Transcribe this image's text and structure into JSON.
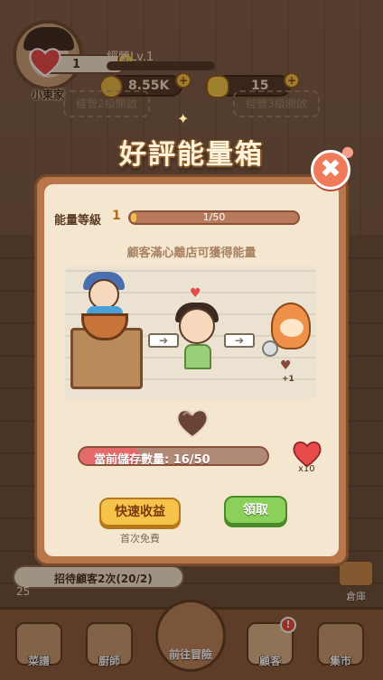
{
  "hud": {
    "name": "小東家",
    "hearts": "1",
    "level_label": "經營Lv.1",
    "coins": "8.55K",
    "gold": "15",
    "locked_left": "經營2級開啟",
    "locked_right": "經營3級開啟"
  },
  "popup": {
    "title": "好評能量箱",
    "close": "✖",
    "level_label": "能量等級",
    "level_value": "1",
    "level_progress_text": "1/50",
    "level_progress": 0.02,
    "subtitle": "顧客滿心離店可獲得能量",
    "plus_one": "+1",
    "storage_text": "當前儲存數量: 16/50",
    "storage_progress": 0.32,
    "reward_count": "x10",
    "quick_button": "快速收益",
    "claim_button": "領取",
    "free_note": "首次免費"
  },
  "task": {
    "text": "招待顧客2次(20/2)",
    "count": "25"
  },
  "warehouse": "倉庫",
  "nav": {
    "items": [
      "菜譜",
      "廚師",
      "前往冒險",
      "顧客",
      "集市"
    ],
    "badge": "!"
  },
  "colors": {
    "heart": "#e64a4a",
    "gold_button": "#f6c44a",
    "green_button": "#8ad05a",
    "close_button": "#f07a5a"
  },
  "icons": [
    "heart-icon",
    "coin-icon",
    "gold-ingot-icon",
    "close-icon",
    "arrow-right-icon"
  ]
}
